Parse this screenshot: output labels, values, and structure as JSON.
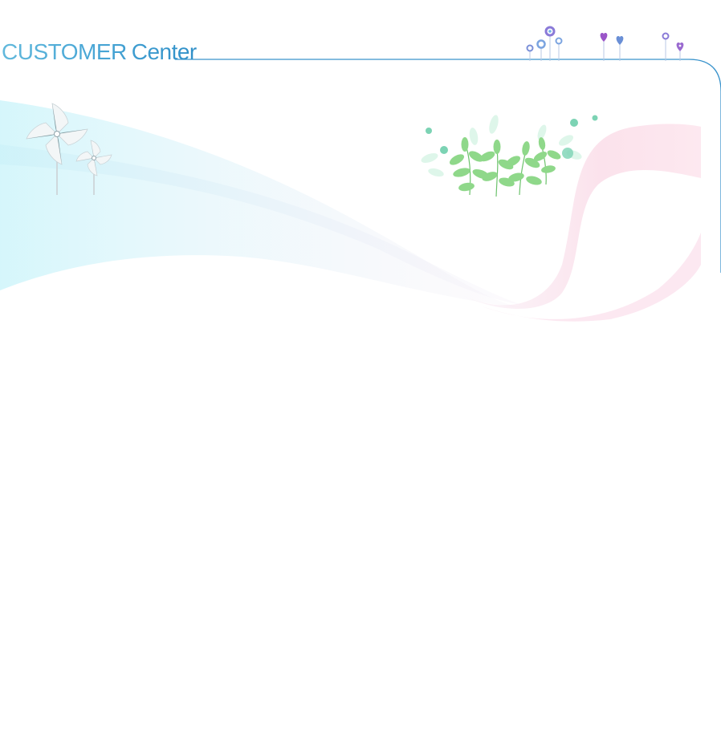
{
  "header": {
    "title_word1": "CUSTOMER",
    "title_word2": "Center"
  },
  "decorations": {
    "pinwheels": "pinwheel-icon",
    "plants": "leaf-plant-icon",
    "flowers": "flower-icon",
    "hearts": "heart-icon"
  },
  "colors": {
    "title_light": "#62b9dc",
    "title_dark": "#2f8fc8",
    "frame_line": "#3a93cc",
    "ribbon_cyan": "#d9f6fb",
    "ribbon_pink": "#fbe2ec",
    "leaf_green": "#8fd88a",
    "flower_blue": "#6a8fd6",
    "heart_purple": "#9a55c8"
  }
}
